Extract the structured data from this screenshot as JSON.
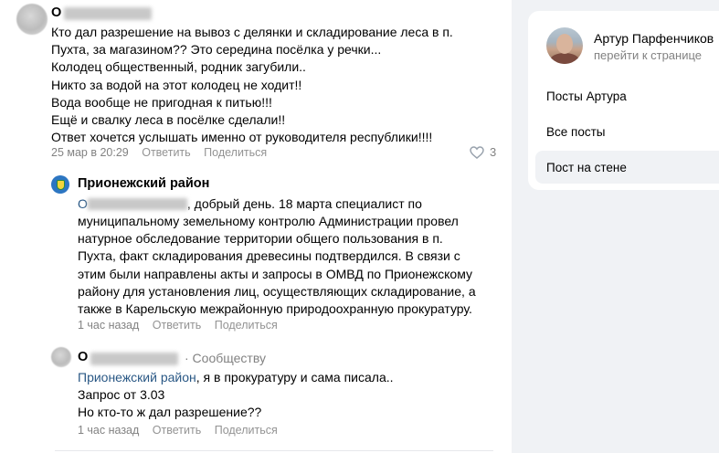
{
  "post": {
    "author_initial": "О",
    "text": "Кто дал разрешение на вывоз с делянки и складирование леса в п.\nПухта, за магазином?? Это середина посёлка у речки...\nКолодец общественный, родник загубили..\nНикто за водой на этот колодец не ходит!!\nВода вообще не пригодная к питью!!!\nЕщё и свалку леса в посёлке сделали!!\nОтвет хочется услышать именно от руководителя республики!!!!",
    "date": "25 мар в 20:29",
    "reply_label": "Ответить",
    "share_label": "Поделиться",
    "like_count": "3"
  },
  "reply1": {
    "author": "Прионежский район",
    "addressee_initial": "О",
    "greeting": ", добрый день. 18 марта специалист по",
    "text": "муниципальному земельному контролю Администрации провел\nнатурное обследование территории общего пользования в п.\nПухта, факт складирования древесины подтвердился. В связи с\nэтим были направлены акты и запросы в ОМВД по Прионежскому\nрайону для установления лиц, осуществляющих складирование, а\nтакже в Карельскую межрайонную природоохранную прокуратуру.",
    "time": "1 час назад",
    "reply_label": "Ответить",
    "share_label": "Поделиться"
  },
  "reply2": {
    "author_initial": "О",
    "badge": "· Сообществу",
    "mention": "Прионежский район",
    "mention_rest": ", я в прокуратуру и сама писала..",
    "text": "Запрос от 3.03\nНо кто-то ж дал разрешение??",
    "time": "1 час назад",
    "reply_label": "Ответить",
    "share_label": "Поделиться"
  },
  "sidebar": {
    "profile_name": "Артур Парфенчиков",
    "profile_link": "перейти к странице",
    "menu": [
      "Посты Артура",
      "Все посты",
      "Пост на стене"
    ],
    "active_index": 2
  },
  "colors": {
    "link": "#2a5885",
    "meta": "#828282",
    "accent": "#2d76c2"
  }
}
